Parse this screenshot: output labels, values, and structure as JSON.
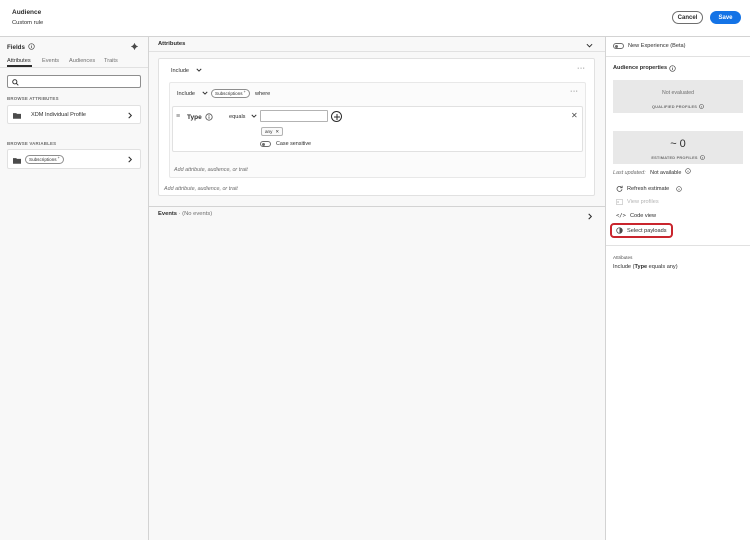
{
  "header": {
    "title": "Audience",
    "subtitle": "Custom rule",
    "cancel_label": "Cancel",
    "save_label": "Save"
  },
  "left": {
    "fields_title": "Fields",
    "tabs": [
      "Attributes",
      "Events",
      "Audiences",
      "Traits"
    ],
    "search_placeholder": "",
    "browse_attributes_label": "BROWSE ATTRIBUTES",
    "xdm_item": "XDM Individual Profile",
    "browse_variables_label": "BROWSE VARIABLES",
    "subscriptions_pill": "Subscriptions"
  },
  "middle": {
    "attributes_title": "Attributes",
    "include_label": "Include",
    "inner_include_label": "Include",
    "inner_pill": "Subscriptions",
    "where_label": "where",
    "type_label": "Type",
    "operator": "equals",
    "value_input": "",
    "tag_any": "any",
    "case_sensitive_label": "Case sensitive",
    "add_inner": "Add attribute, audience, or trait",
    "add_outer": "Add attribute, audience, or trait",
    "events_title": "Events",
    "events_sub": "· (No events)"
  },
  "right": {
    "new_experience_label": "New Experience (Beta)",
    "audience_properties_title": "Audience properties",
    "not_evaluated": "Not evaluated",
    "qualified_profiles": "QUALIFIED PROFILES",
    "estimated_value": "~ 0",
    "estimated_profiles": "ESTIMATED PROFILES",
    "last_updated_label": "Last updated:",
    "last_updated_value": "Not available",
    "refresh_estimate": "Refresh estimate",
    "view_profiles": "View profiles",
    "code_view": "Code view",
    "select_payloads": "Select payloads",
    "attributes_heading": "Attributes",
    "rule_prefix": "Include (",
    "rule_type": "Type",
    "rule_suffix": " equals any)"
  },
  "colors": {
    "accent": "#1473e6",
    "highlight_red": "#c9252d"
  }
}
